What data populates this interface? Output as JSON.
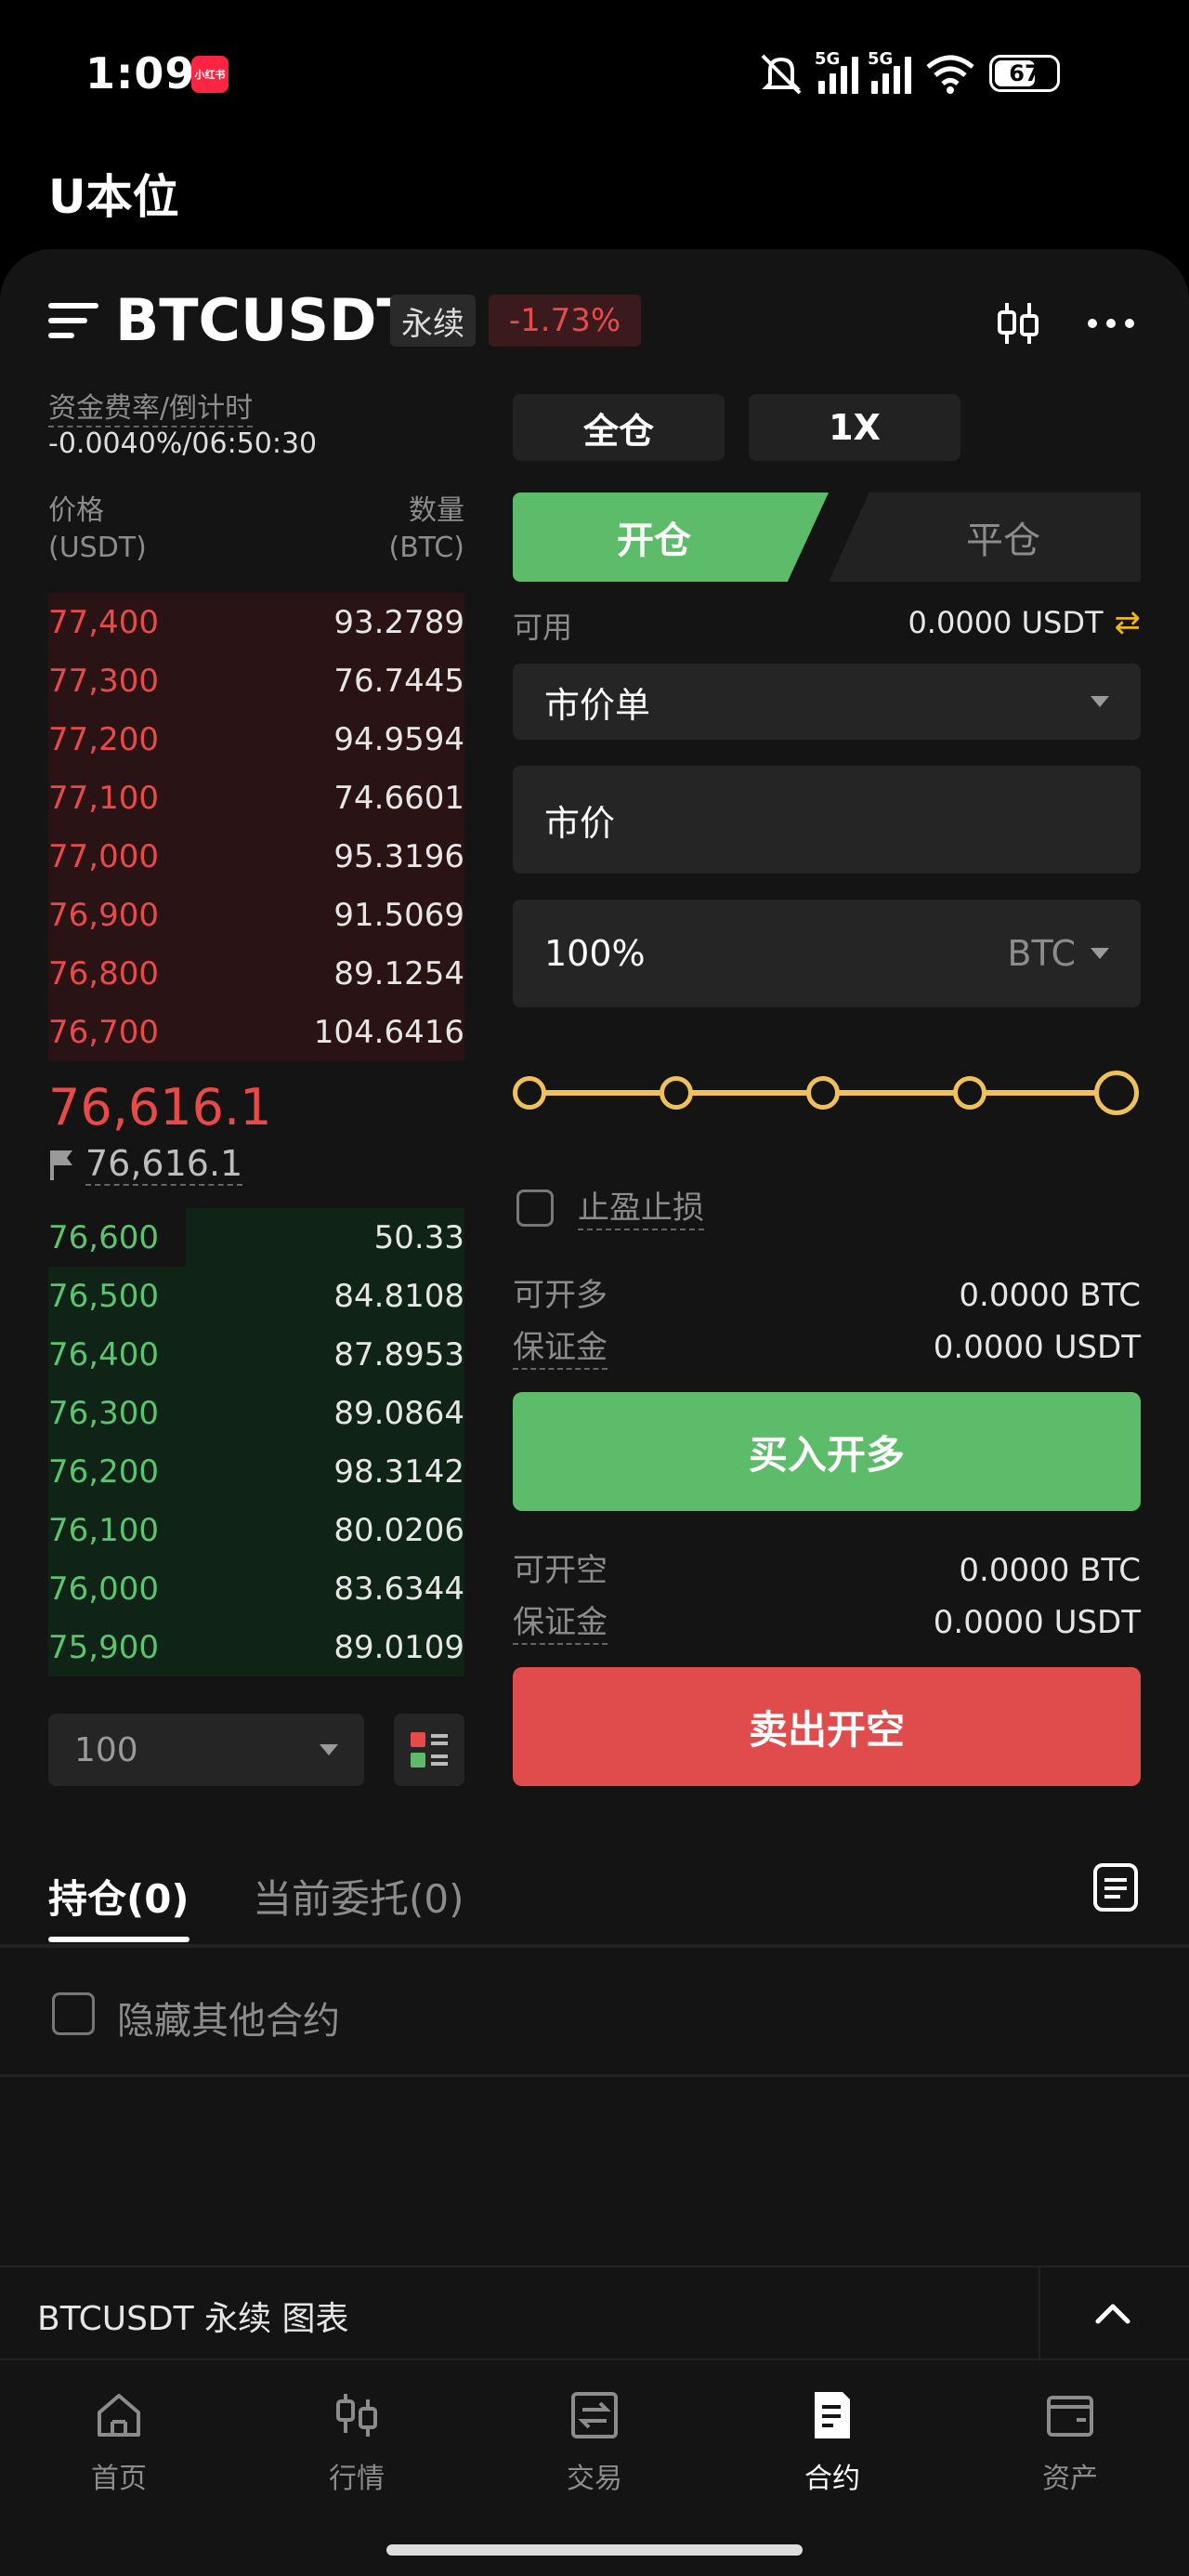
{
  "status": {
    "time": "1:09",
    "app_badge": "小红书",
    "sim1": "5G",
    "sim2": "5G",
    "battery": "67"
  },
  "page": {
    "title": "U本位"
  },
  "header": {
    "symbol": "BTCUSDT",
    "contract_tag": "永续",
    "change": "-1.73%"
  },
  "funding": {
    "label": "资金费率/倒计时",
    "value": "-0.0040%/06:50:30"
  },
  "orderbook": {
    "price_header": [
      "价格",
      "(USDT)"
    ],
    "qty_header": [
      "数量",
      "(BTC)"
    ],
    "asks": [
      {
        "price": "77,400",
        "qty": "93.2789",
        "depth": 1.0
      },
      {
        "price": "77,300",
        "qty": "76.7445",
        "depth": 1.0
      },
      {
        "price": "77,200",
        "qty": "94.9594",
        "depth": 1.0
      },
      {
        "price": "77,100",
        "qty": "74.6601",
        "depth": 1.0
      },
      {
        "price": "77,000",
        "qty": "95.3196",
        "depth": 1.0
      },
      {
        "price": "76,900",
        "qty": "91.5069",
        "depth": 1.0
      },
      {
        "price": "76,800",
        "qty": "89.1254",
        "depth": 1.0
      },
      {
        "price": "76,700",
        "qty": "104.6416",
        "depth": 1.0
      }
    ],
    "last_price": "76,616.1",
    "mark_price": "76,616.1",
    "bids": [
      {
        "price": "76,600",
        "qty": "50.33",
        "depth": 0.67
      },
      {
        "price": "76,500",
        "qty": "84.8108",
        "depth": 1.0
      },
      {
        "price": "76,400",
        "qty": "87.8953",
        "depth": 1.0
      },
      {
        "price": "76,300",
        "qty": "89.0864",
        "depth": 1.0
      },
      {
        "price": "76,200",
        "qty": "98.3142",
        "depth": 1.0
      },
      {
        "price": "76,100",
        "qty": "80.0206",
        "depth": 1.0
      },
      {
        "price": "76,000",
        "qty": "83.6344",
        "depth": 1.0
      },
      {
        "price": "75,900",
        "qty": "89.0109",
        "depth": 1.0
      }
    ],
    "depth_step": "100"
  },
  "trade": {
    "margin_mode": "全仓",
    "leverage": "1X",
    "tab_open": "开仓",
    "tab_close": "平仓",
    "available_label": "可用",
    "available_value": "0.0000 USDT",
    "order_type": "市价单",
    "price_field": "市价",
    "amount_field": "100%",
    "amount_unit": "BTC",
    "slider_percent": 100,
    "tpsl_label": "止盈止损",
    "long_qty_label": "可开多",
    "long_qty_value": "0.0000 BTC",
    "long_margin_label": "保证金",
    "long_margin_value": "0.0000 USDT",
    "buy_button": "买入开多",
    "short_qty_label": "可开空",
    "short_qty_value": "0.0000 BTC",
    "short_margin_label": "保证金",
    "short_margin_value": "0.0000 USDT",
    "sell_button": "卖出开空"
  },
  "positions": {
    "tab_positions": "持仓(0)",
    "tab_orders": "当前委托(0)",
    "hide_others": "隐藏其他合约"
  },
  "chart_bar": {
    "label": "BTCUSDT 永续 图表"
  },
  "nav": [
    {
      "label": "首页",
      "icon": "home-icon"
    },
    {
      "label": "行情",
      "icon": "market-icon"
    },
    {
      "label": "交易",
      "icon": "trade-icon"
    },
    {
      "label": "合约",
      "icon": "futures-icon"
    },
    {
      "label": "资产",
      "icon": "wallet-icon"
    }
  ],
  "colors": {
    "up": "#5cbc6a",
    "down": "#e84a4a",
    "accent": "#f0c05a",
    "bg": "#141414"
  }
}
